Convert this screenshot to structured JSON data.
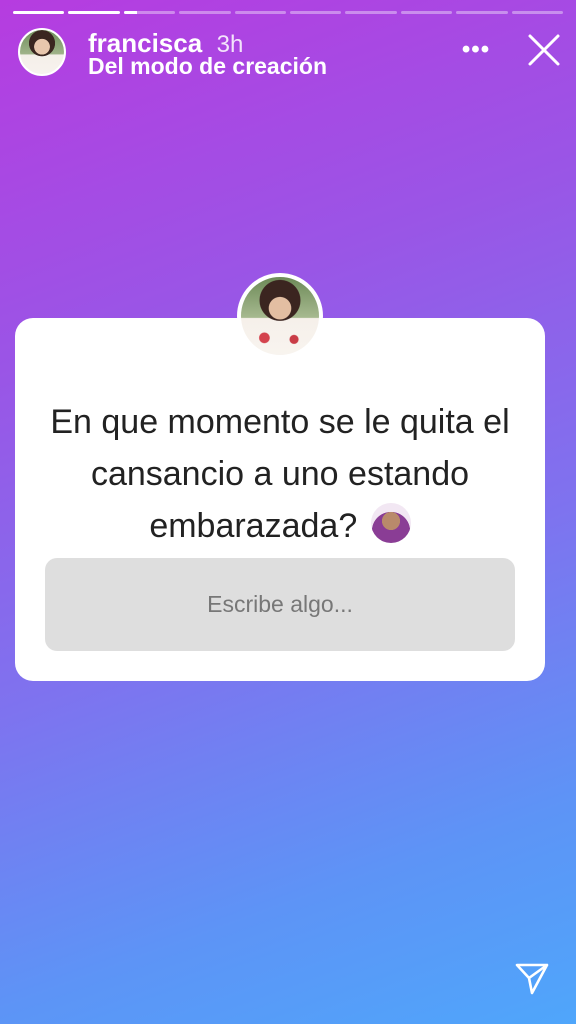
{
  "story": {
    "segment_count": 10,
    "active_segment": 3,
    "active_segment_progress": 0.25
  },
  "header": {
    "username": "francisca",
    "time": "3h",
    "subtitle": "Del modo de creación",
    "more_icon": "more-horizontal-icon",
    "close_icon": "close-icon"
  },
  "question_card": {
    "question": "En que momento se le quita el cansancio a uno estando embarazada?",
    "emoji": "woman-gesturing-ok-emoji",
    "input_placeholder": "Escribe algo..."
  },
  "footer": {
    "send_icon": "send-icon"
  },
  "colors": {
    "gradient_start": "#b63ce0",
    "gradient_end": "#4fa6fb",
    "card_background": "#ffffff",
    "input_background": "#dedede"
  }
}
